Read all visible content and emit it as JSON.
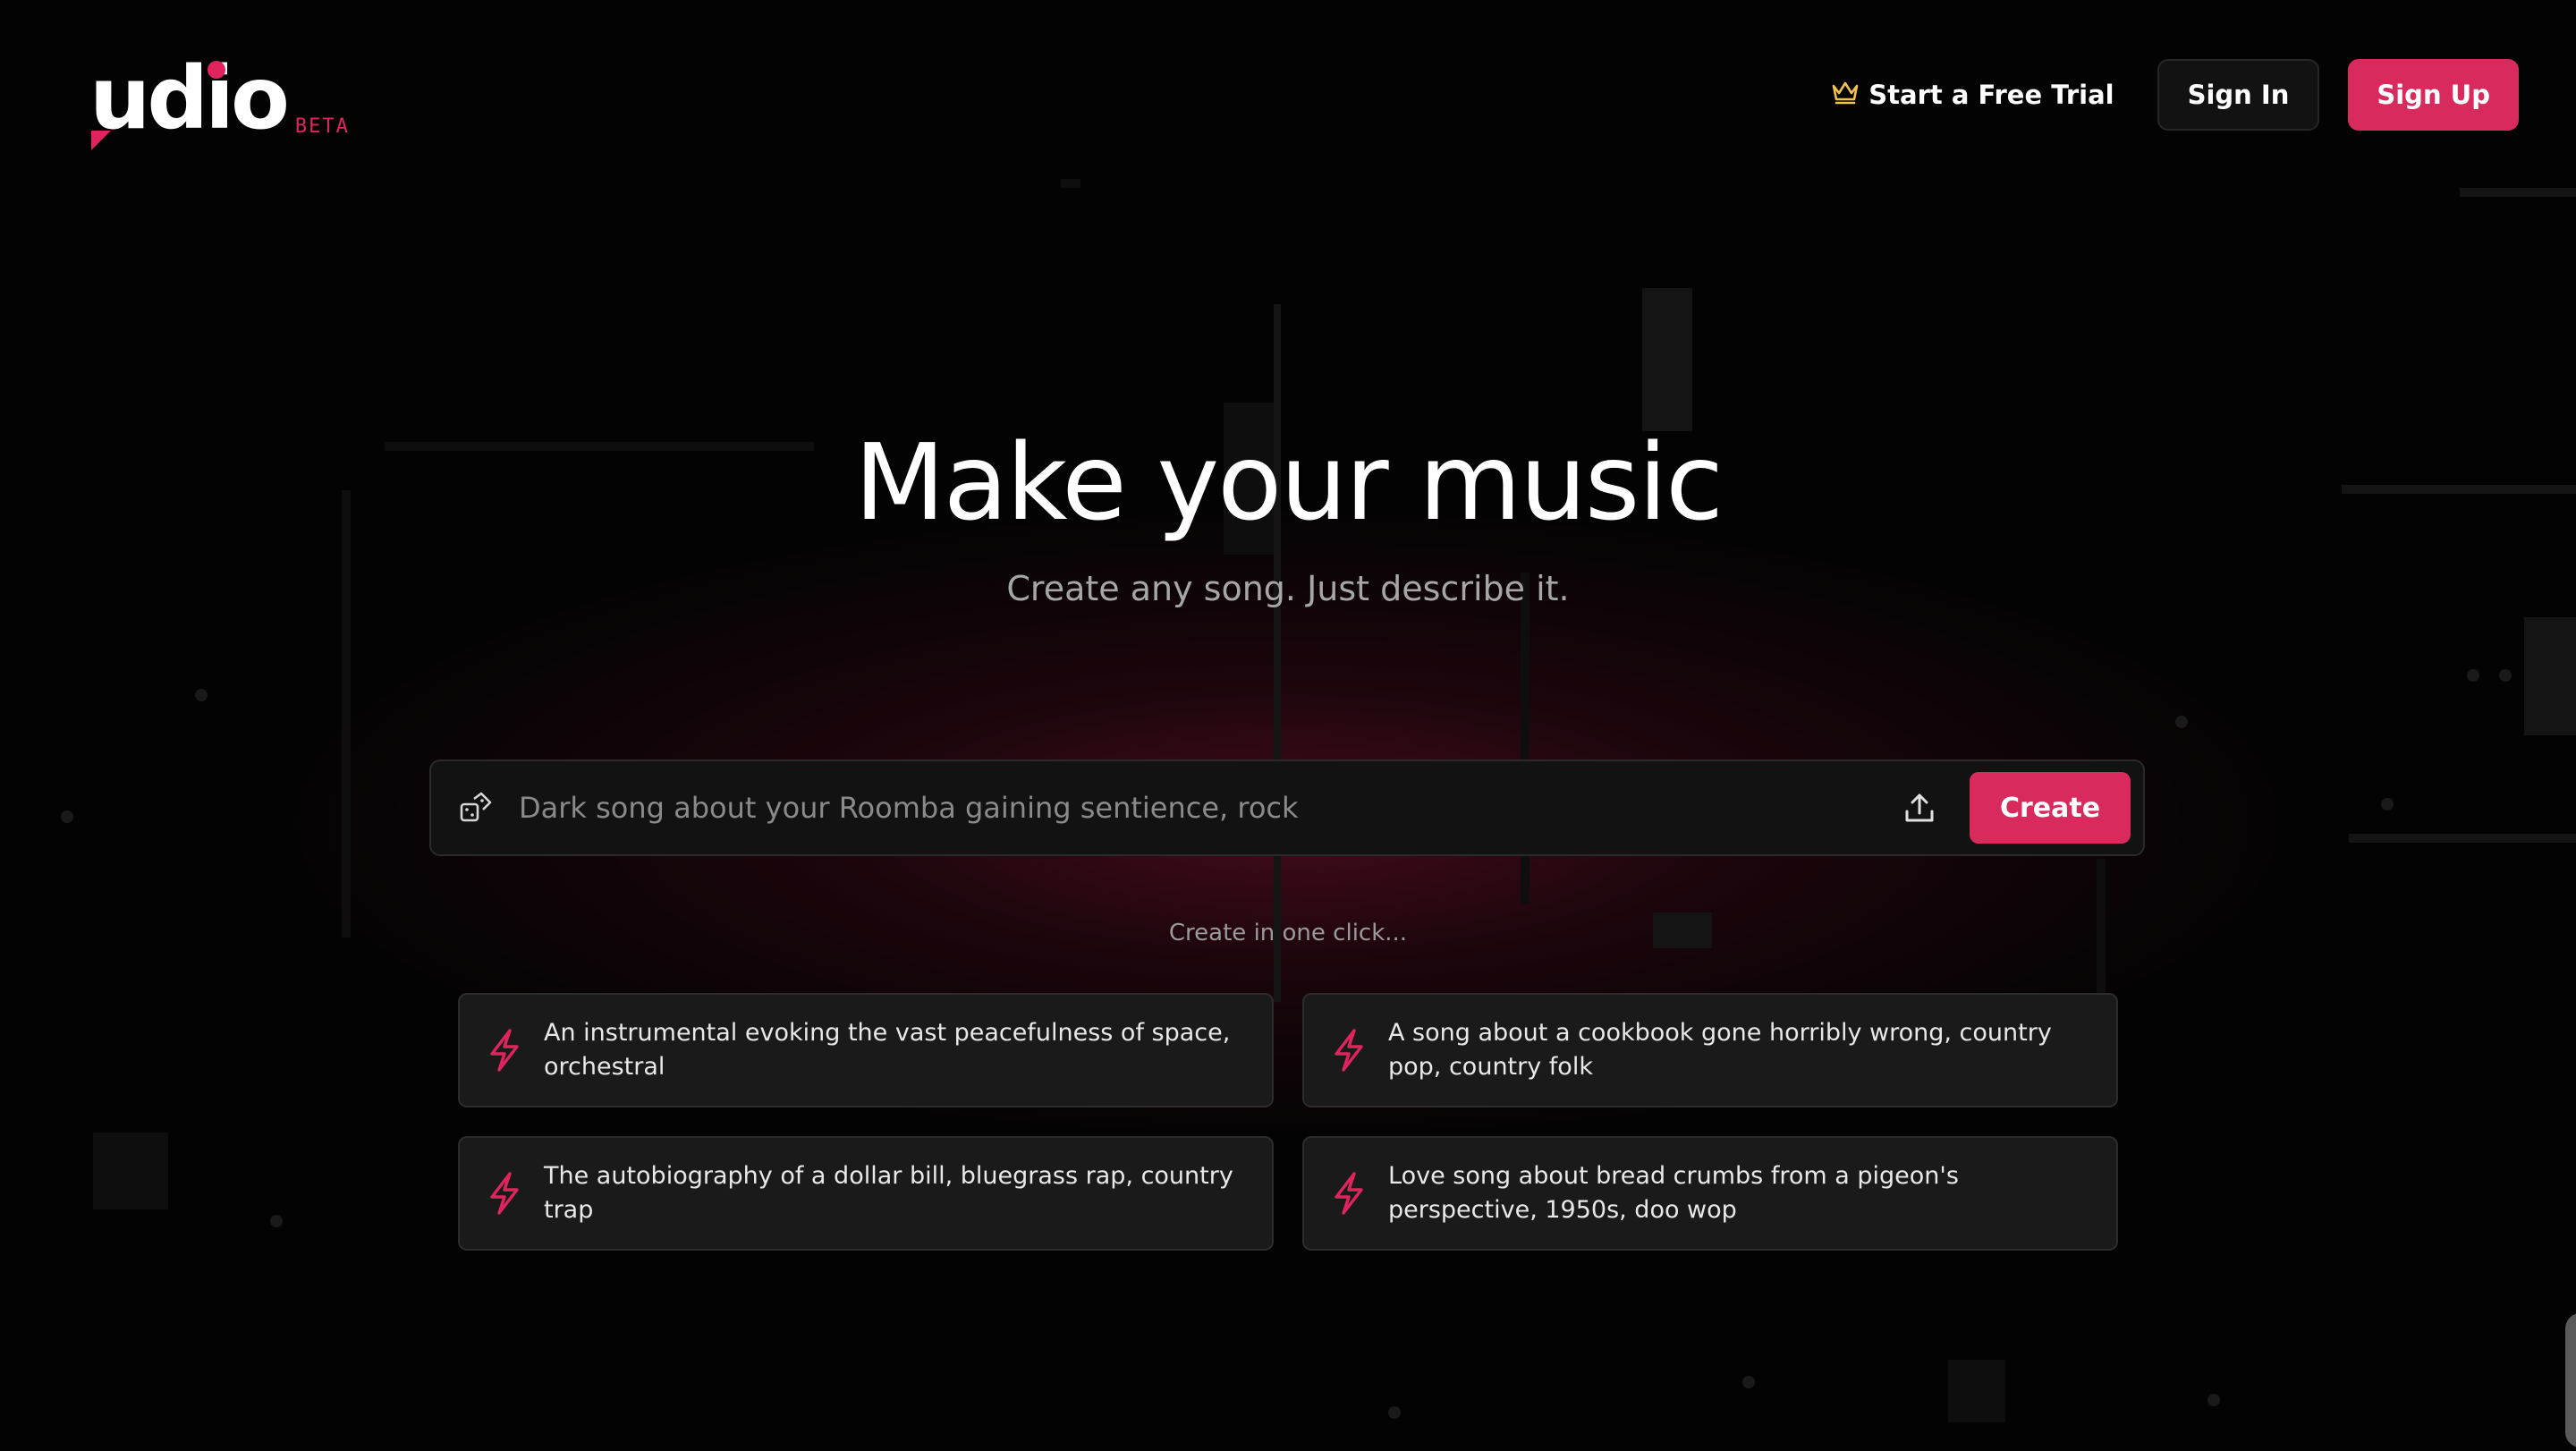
{
  "header": {
    "logo_text": "udio",
    "beta_label": "BETA",
    "trial_label": "Start a Free Trial",
    "signin_label": "Sign In",
    "signup_label": "Sign Up"
  },
  "hero": {
    "title": "Make your music",
    "subtitle": "Create any song. Just describe it."
  },
  "prompt": {
    "placeholder": "Dark song about your Roomba gaining sentience, rock",
    "value": "",
    "create_label": "Create"
  },
  "suggestions": {
    "heading": "Create in one click...",
    "items": [
      {
        "text": "An instrumental evoking the vast peacefulness of space, orchestral"
      },
      {
        "text": "A song about a cookbook gone horribly wrong, country pop, country folk"
      },
      {
        "text": "The autobiography of a dollar bill, bluegrass rap, country trap"
      },
      {
        "text": "Love song about bread crumbs from a pigeon's perspective, 1950s, doo wop"
      }
    ]
  },
  "colors": {
    "accent": "#d92a5e",
    "crown": "#f2c14e",
    "background": "#030303"
  },
  "icons": {
    "trial": "crown-icon",
    "random": "dice-icon",
    "upload": "upload-icon",
    "suggestion": "lightning-icon"
  }
}
